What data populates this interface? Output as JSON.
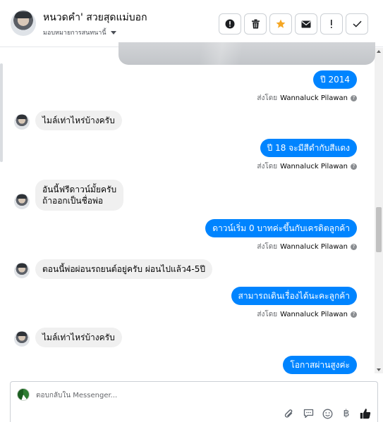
{
  "header": {
    "contact_name": "หนวดคำ' สวยสุดแม่บอก",
    "assign_label": "มอบหมายการสนทนานี้",
    "actions": [
      {
        "name": "alert-circle",
        "icon": "exclamation-circle-icon"
      },
      {
        "name": "delete",
        "icon": "trash-icon"
      },
      {
        "name": "star",
        "icon": "star-icon",
        "color": "#f5a623"
      },
      {
        "name": "email",
        "icon": "envelope-icon"
      },
      {
        "name": "important",
        "icon": "exclamation-icon"
      },
      {
        "name": "done",
        "icon": "checkmark-icon"
      }
    ]
  },
  "messages": {
    "sent_by_prefix": "ส่งโดย",
    "sender": "Wannaluck Pilawan",
    "items": [
      {
        "dir": "out",
        "text": "ปี 2014"
      },
      {
        "dir": "in",
        "text": "ไมล์เท่าไหร่บ้างครับ"
      },
      {
        "dir": "out",
        "text": "ปี 18 จะมีสีดำกับสีแดง"
      },
      {
        "dir": "in",
        "line1": "อันนี้ฟรีดาวน์มั้ยครับ",
        "line2": "ถ้าออกเป็นชื่อพ่อ"
      },
      {
        "dir": "out",
        "text": "ดาวน์เริ่ม 0 บาทค่ะขึ้นกับเครดิตลูกค้า"
      },
      {
        "dir": "in",
        "text": "ตอนนี้พ่อผ่อนรถยนต์อยู่ครับ ผ่อนไปแล้ว4-5ปี"
      },
      {
        "dir": "out",
        "text": "สามารถเดินเรื่องได้นะคะลูกค้า"
      },
      {
        "dir": "in",
        "text": "ไมล์เท่าไหร่บ้างครับ"
      },
      {
        "dir": "out",
        "text": "โอกาสผ่านสูงค่ะ"
      }
    ]
  },
  "composer": {
    "placeholder": "ตอบกลับใน Messenger...",
    "tools": [
      "paperclip-icon",
      "speech-bubble-icon",
      "emoji-icon",
      "baht-icon",
      "thumbs-up-icon"
    ],
    "baht_symbol": "฿"
  },
  "colors": {
    "outgoing_bubble": "#0084ff",
    "incoming_bubble": "#f0f0f0",
    "star": "#f5a623"
  }
}
